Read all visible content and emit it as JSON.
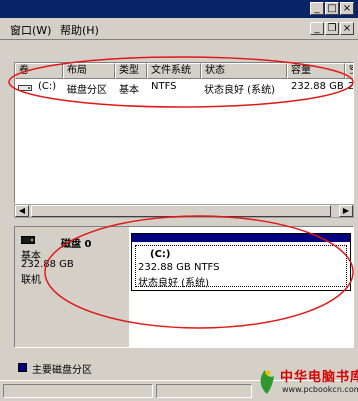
{
  "menubar": {
    "window_label": "窗口(W)",
    "help_label": "帮助(H)"
  },
  "window_controls": {
    "minimize": "_",
    "maximize": "□",
    "close": "×"
  },
  "mdi_controls": {
    "minimize": "_",
    "restore": "❐",
    "close": "×"
  },
  "volume_list": {
    "columns": [
      "卷",
      "布局",
      "类型",
      "文件系统",
      "状态",
      "容量",
      "空"
    ],
    "rows": [
      {
        "volume": "(C:)",
        "layout": "磁盘分区",
        "type": "基本",
        "filesystem": "NTFS",
        "status": "状态良好 (系统)",
        "capacity": "232.88 GB",
        "free": "2"
      }
    ]
  },
  "scrollbar": {
    "left_arrow": "◀",
    "right_arrow": "▶"
  },
  "disk": {
    "name": "磁盘 0",
    "type": "基本",
    "size": "232.88 GB",
    "status": "联机"
  },
  "partition": {
    "name": "(C:)",
    "size_fs": "232.88 GB NTFS",
    "status": "状态良好 (系统)"
  },
  "legend": {
    "label": "主要磁盘分区",
    "color": "#000080"
  },
  "watermark": {
    "title": "中华电脑书库",
    "url": "www.pcbookcn.com"
  },
  "annotation_color": "#e01818"
}
